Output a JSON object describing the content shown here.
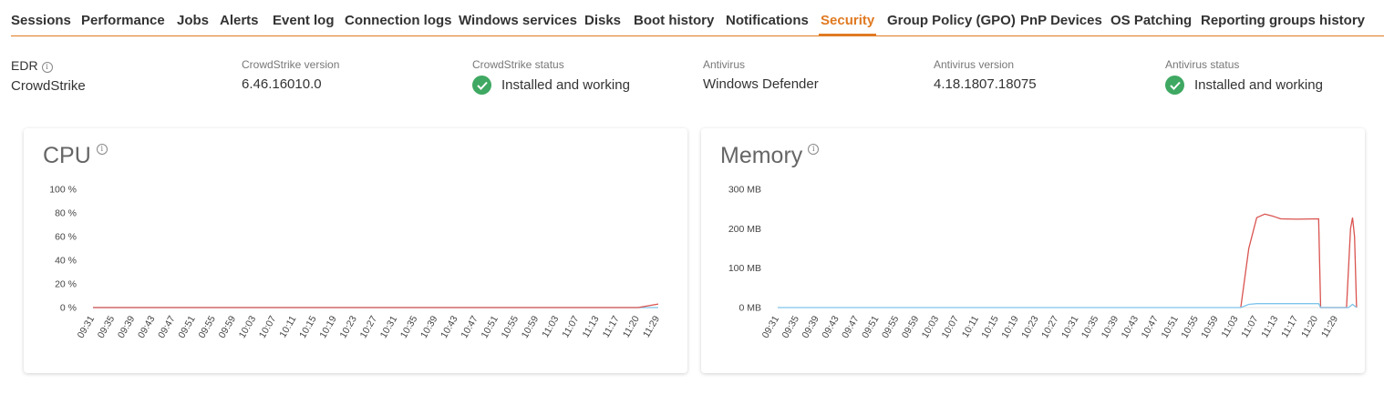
{
  "tabs": [
    "Sessions",
    "Performance",
    "Jobs",
    "Alerts",
    "Event log",
    "Connection logs",
    "Windows services",
    "Disks",
    "Boot history",
    "Notifications",
    "Security",
    "Group Policy (GPO)",
    "PnP Devices",
    "OS Patching",
    "Reporting groups history"
  ],
  "active_tab": "Security",
  "security": {
    "edr_label": "EDR",
    "edr_value": "CrowdStrike",
    "cs_version_label": "CrowdStrike version",
    "cs_version_value": "6.46.16010.0",
    "cs_status_label": "CrowdStrike status",
    "cs_status_value": "Installed and working",
    "av_label": "Antivirus",
    "av_value": "Windows Defender",
    "av_version_label": "Antivirus version",
    "av_version_value": "4.18.1807.18075",
    "av_status_label": "Antivirus status",
    "av_status_value": "Installed and working"
  },
  "colors": {
    "accent": "#e07a22",
    "ok_green": "#3fa862",
    "series_red": "#d9534f",
    "series_blue": "#7fc4ec"
  },
  "chart_data": [
    {
      "type": "line",
      "title": "CPU",
      "y_tick_labels": [
        "0 %",
        "20 %",
        "40 %",
        "60 %",
        "80 %",
        "100 %"
      ],
      "ylim": [
        0,
        100
      ],
      "x": [
        "09:31",
        "09:35",
        "09:39",
        "09:43",
        "09:47",
        "09:51",
        "09:55",
        "09:59",
        "10:03",
        "10:07",
        "10:11",
        "10:15",
        "10:19",
        "10:23",
        "10:27",
        "10:31",
        "10:35",
        "10:39",
        "10:43",
        "10:47",
        "10:51",
        "10:55",
        "10:59",
        "11:03",
        "11:07",
        "11:13",
        "11:17",
        "11:20",
        "11:29"
      ],
      "series": [
        {
          "color": "#7fc4ec",
          "values": [
            0,
            0,
            0,
            0,
            0,
            0,
            0,
            0,
            0,
            0,
            0,
            0,
            0,
            0,
            0,
            0,
            0,
            0,
            0,
            0,
            0,
            0,
            0,
            0,
            0,
            0,
            0,
            0,
            0
          ]
        },
        {
          "color": "#d9534f",
          "values": [
            0,
            0,
            0,
            0,
            0,
            0,
            0,
            0,
            0,
            0,
            0,
            0,
            0,
            0,
            0,
            0,
            0,
            0,
            0,
            0,
            0,
            0,
            0,
            0,
            0,
            0,
            0,
            0,
            3
          ]
        }
      ]
    },
    {
      "type": "line",
      "title": "Memory",
      "y_tick_labels": [
        "0 MB",
        "100 MB",
        "200 MB",
        "300 MB"
      ],
      "ylim": [
        0,
        300
      ],
      "x": [
        "09:31",
        "09:35",
        "09:39",
        "09:43",
        "09:47",
        "09:51",
        "09:55",
        "09:59",
        "10:03",
        "10:07",
        "10:11",
        "10:15",
        "10:19",
        "10:23",
        "10:27",
        "10:31",
        "10:35",
        "10:39",
        "10:43",
        "10:47",
        "10:51",
        "10:55",
        "10:59",
        "11:03",
        "11:07",
        "11:13",
        "11:17",
        "11:20",
        "11:29"
      ],
      "series": [
        {
          "color": "#d9534f",
          "points": [
            [
              23.2,
              0
            ],
            [
              23.6,
              150
            ],
            [
              24.0,
              228
            ],
            [
              24.4,
              237
            ],
            [
              24.8,
              232
            ],
            [
              25.2,
              225
            ],
            [
              26.0,
              224
            ],
            [
              27.1,
              225
            ],
            [
              27.2,
              0
            ],
            [
              28.5,
              0
            ],
            [
              28.7,
              200
            ],
            [
              28.8,
              228
            ],
            [
              28.9,
              180
            ],
            [
              29.0,
              0
            ]
          ]
        },
        {
          "color": "#7fc4ec",
          "points": [
            [
              0,
              0
            ],
            [
              23.2,
              0
            ],
            [
              23.6,
              8
            ],
            [
              24.0,
              10
            ],
            [
              27.1,
              10
            ],
            [
              27.2,
              0
            ],
            [
              28.6,
              0
            ],
            [
              28.8,
              8
            ],
            [
              29.0,
              0
            ]
          ]
        }
      ]
    }
  ]
}
